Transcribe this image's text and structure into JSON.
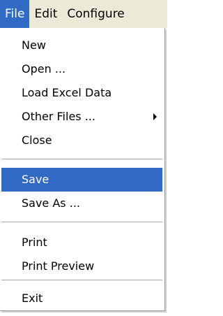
{
  "menubar": {
    "items": [
      {
        "label": "File"
      },
      {
        "label": "Edit"
      },
      {
        "label": "Configure"
      }
    ]
  },
  "file_menu": {
    "new": "New",
    "open": "Open ...",
    "load_excel": "Load Excel Data",
    "other_files": "Other Files ...",
    "close": "Close",
    "save": "Save",
    "save_as": "Save As ...",
    "print": "Print",
    "print_preview": "Print Preview",
    "exit": "Exit"
  },
  "colors": {
    "highlight": "#316ac5",
    "menubar_bg": "#ece9d8"
  }
}
